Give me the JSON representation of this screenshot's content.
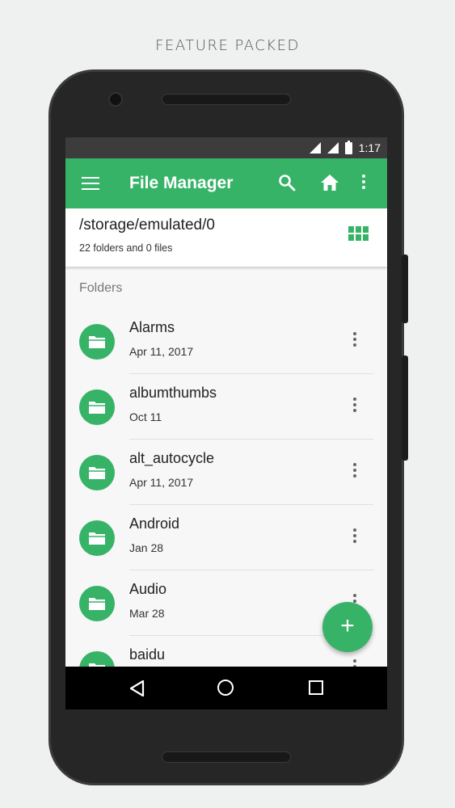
{
  "caption": "FEATURE PACKED",
  "status_bar": {
    "time": "1:17"
  },
  "app_bar": {
    "title": "File Manager",
    "menu_icon": "menu-icon",
    "search_icon": "search-icon",
    "home_icon": "home-icon",
    "more_icon": "more-vert-icon"
  },
  "path_bar": {
    "path": "/storage/emulated/0",
    "summary": "22 folders and 0 files",
    "view_toggle_icon": "grid-view-icon"
  },
  "list": {
    "section_title": "Folders",
    "items": [
      {
        "name": "Alarms",
        "date": "Apr 11, 2017"
      },
      {
        "name": "albumthumbs",
        "date": "Oct 11"
      },
      {
        "name": "alt_autocycle",
        "date": "Apr 11, 2017"
      },
      {
        "name": "Android",
        "date": "Jan 28"
      },
      {
        "name": "Audio",
        "date": "Mar 28"
      },
      {
        "name": "baidu",
        "date": ""
      }
    ]
  },
  "fab": {
    "label": "+"
  },
  "colors": {
    "accent": "#37b368",
    "status_bar": "#3c3c3c"
  }
}
